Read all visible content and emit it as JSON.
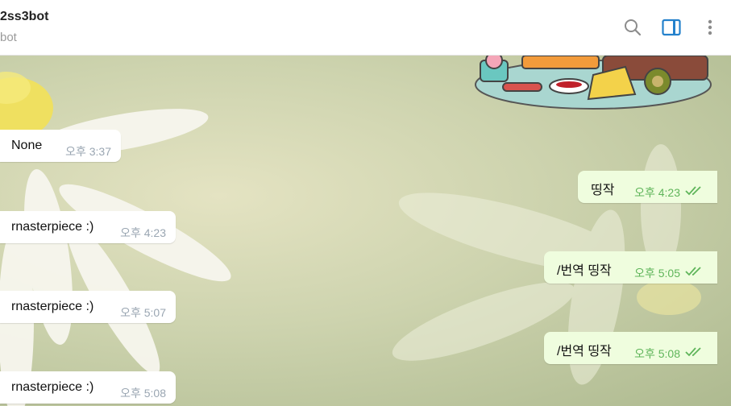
{
  "header": {
    "title": "2ss3bot",
    "subtitle": "bot",
    "icons": [
      "search-icon",
      "sidebar-panel-icon",
      "more-vert-icon"
    ],
    "accent_color": "#2481cc"
  },
  "messages": [
    {
      "direction": "in",
      "text": "None",
      "time": "오후 3:37"
    },
    {
      "direction": "out",
      "text": "띵작",
      "time": "오후 4:23",
      "read": true
    },
    {
      "direction": "in",
      "text": "rnasterpiece :)",
      "time": "오후 4:23"
    },
    {
      "direction": "out",
      "text": "/번역 띵작",
      "time": "오후 5:05",
      "read": true
    },
    {
      "direction": "in",
      "text": "rnasterpiece :)",
      "time": "오후 5:07"
    },
    {
      "direction": "out",
      "text": "/번역 띵작",
      "time": "오후 5:08",
      "read": true
    },
    {
      "direction": "in",
      "text": "rnasterpiece :)",
      "time": "오후 5:08"
    }
  ],
  "sticker": {
    "name": "sushi-platter-sticker"
  },
  "colors": {
    "incoming_bubble": "#ffffff",
    "outgoing_bubble": "#effdde",
    "outgoing_time": "#5fb55a",
    "incoming_time": "#9aa6b2"
  }
}
